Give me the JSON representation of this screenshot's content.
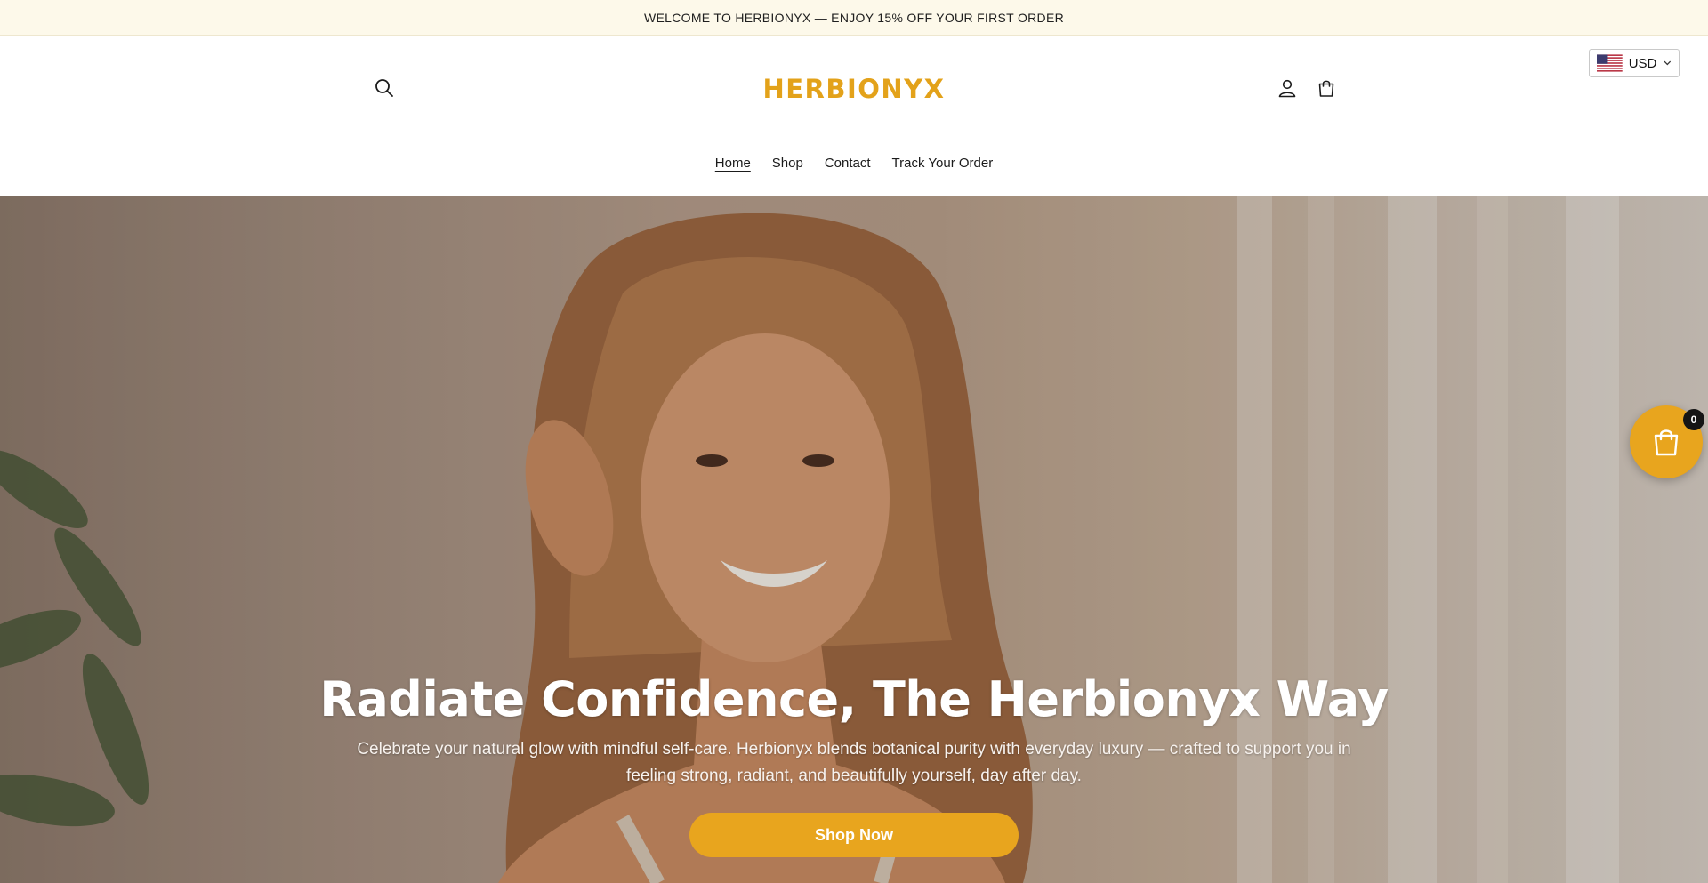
{
  "announcement": {
    "text": "WELCOME TO HERBIONYX — ENJOY 15% OFF YOUR FIRST ORDER"
  },
  "header": {
    "logo": "HERBIONYX",
    "search_icon": "search-icon",
    "account_icon": "user-icon",
    "cart_icon": "bag-icon",
    "currency": {
      "selected": "USD",
      "flag_icon": "us-flag-icon",
      "chevron_icon": "chevron-down-icon"
    }
  },
  "nav": {
    "items": [
      {
        "label": "Home",
        "active": true
      },
      {
        "label": "Shop",
        "active": false
      },
      {
        "label": "Contact",
        "active": false
      },
      {
        "label": "Track Your Order",
        "active": false
      }
    ]
  },
  "hero": {
    "title": "Radiate Confidence, The Herbionyx Way",
    "subtitle": "Celebrate your natural glow with mindful self-care. Herbionyx blends botanical purity with everyday luxury — crafted to support you in feeling strong, radiant, and beautifully yourself, day after day.",
    "cta_label": "Shop Now"
  },
  "floating_cart": {
    "icon": "shopping-bag-icon",
    "count": "0"
  },
  "colors": {
    "accent": "#e8a51e",
    "logo": "#e3a21a",
    "announcement_bg": "#fdf9ea"
  }
}
